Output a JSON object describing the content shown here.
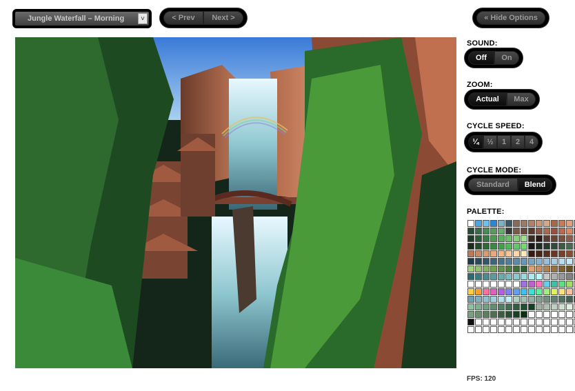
{
  "scene_select": {
    "value": "Jungle Waterfall – Morning",
    "arrow": "˅"
  },
  "nav": {
    "prev": "< Prev",
    "next": "Next >"
  },
  "options_button": "« Hide Options",
  "sound": {
    "label": "SOUND:",
    "options": [
      "Off",
      "On"
    ],
    "selected": "Off"
  },
  "zoom": {
    "label": "ZOOM:",
    "options": [
      "Actual",
      "Max"
    ],
    "selected": "Actual"
  },
  "cycle_speed": {
    "label": "CYCLE SPEED:",
    "options": [
      "¼",
      "½",
      "1",
      "2",
      "4"
    ],
    "selected": "¼"
  },
  "cycle_mode": {
    "label": "CYCLE MODE:",
    "options": [
      "Standard",
      "Blend"
    ],
    "selected": "Blend"
  },
  "palette": {
    "label": "PALETTE:",
    "colors": [
      "#ffffff",
      "#4ea6e0",
      "#6ec0f0",
      "#2c86d8",
      "#80b0c8",
      "#3a5a68",
      "#8a6a58",
      "#9a7a68",
      "#b08068",
      "#c89878",
      "#d8a888",
      "#a86848",
      "#c87a58",
      "#e0a080",
      "#a0a0a0",
      "#6a7a70",
      "#2a4a3a",
      "#3a6a4a",
      "#4a8a58",
      "#5a9a60",
      "#6aaa70",
      "#3a3a3a",
      "#7a5a48",
      "#6a4a3a",
      "#5a3a2e",
      "#8a5a46",
      "#aa6a50",
      "#9a5040",
      "#b86a4e",
      "#d88a68",
      "#7a4a3a",
      "#4a2a22",
      "#1e3a2a",
      "#2a5a3a",
      "#3a7a46",
      "#4a9a50",
      "#5ab05a",
      "#6ac068",
      "#88d078",
      "#a0e090",
      "#3a2a22",
      "#2a1a16",
      "#5a3a30",
      "#6a4436",
      "#7a5040",
      "#8a5c4a",
      "#9a6854",
      "#aa7460",
      "#1a2a1e",
      "#244a2c",
      "#2e6a38",
      "#388a42",
      "#42a04c",
      "#50b858",
      "#60c868",
      "#74d878",
      "#181818",
      "#202a24",
      "#2a3a2e",
      "#344a3a",
      "#3e5a44",
      "#486a50",
      "#527a5a",
      "#5c8a66",
      "#ba7a58",
      "#ca8a64",
      "#da9a70",
      "#eaaa7c",
      "#f0b888",
      "#f6c898",
      "#ffd8a8",
      "#ffe8c0",
      "#3a1a10",
      "#4a2416",
      "#5a2e1c",
      "#6a3822",
      "#7a4228",
      "#8a4c2e",
      "#9a5634",
      "#aa603a",
      "#223a46",
      "#2a4a58",
      "#34566a",
      "#3e647a",
      "#48728a",
      "#527e9a",
      "#5c8aaa",
      "#6896b8",
      "#78a4c4",
      "#88b2d0",
      "#98c0dc",
      "#a8cee6",
      "#b8dcf0",
      "#c8e8f8",
      "#d8f0ff",
      "#e8f8ff",
      "#a0d080",
      "#90c070",
      "#80b060",
      "#70a050",
      "#60904a",
      "#508040",
      "#407038",
      "#306030",
      "#e0a070",
      "#c89060",
      "#b08050",
      "#987040",
      "#806030",
      "#685020",
      "#504010",
      "#383000",
      "#2a6a70",
      "#3a7a80",
      "#4a8a90",
      "#5a9aa0",
      "#6aaab0",
      "#7abac0",
      "#8acad0",
      "#9adae0",
      "#aaeaf0",
      "#bafaff",
      "#c8c8c8",
      "#b0b0b0",
      "#989898",
      "#808080",
      "#686868",
      "#505050",
      "#ffffff",
      "#ffffff",
      "#ffffff",
      "#ffffff",
      "#ffffff",
      "#ffffff",
      "#ffffff",
      "#a070e0",
      "#c060d0",
      "#ff70c0",
      "#60d0f0",
      "#40c0a0",
      "#60e080",
      "#a0e060",
      "#e0e060",
      "#f0a040",
      "#ffcf40",
      "#ff9f30",
      "#ff70a0",
      "#e060c0",
      "#b060e0",
      "#8080f0",
      "#60a0f0",
      "#40c0f0",
      "#40e0d0",
      "#60f0a0",
      "#a0f080",
      "#e0f060",
      "#ffe080",
      "#ffc0a0",
      "#ffa0c0",
      "#e0a0ff",
      "#70a0b0",
      "#80b0c0",
      "#90c0d0",
      "#a0d0e0",
      "#b0e0f0",
      "#c0f0ff",
      "#b0d0c0",
      "#a0c0b0",
      "#90b0a0",
      "#80a090",
      "#709080",
      "#608070",
      "#507060",
      "#406050",
      "#305040",
      "#203030",
      "#90c0a0",
      "#80b090",
      "#70a080",
      "#609070",
      "#508060",
      "#407050",
      "#306040",
      "#205030",
      "#104020",
      "#a0b0a0",
      "#b0c0b0",
      "#c0d0c0",
      "#d0e0d0",
      "#e0f0e0",
      "#f0fff0",
      "#ffffff",
      "#7aa080",
      "#6a9070",
      "#5a8060",
      "#4a7050",
      "#3a6040",
      "#2a5030",
      "#1a4020",
      "#0a3010",
      "#ffffff",
      "#ffffff",
      "#ffffff",
      "#ffffff",
      "#ffffff",
      "#ffffff",
      "#ffffff",
      "#ffffff",
      "#101010",
      "#ffffff",
      "#ffffff",
      "#ffffff",
      "#ffffff",
      "#ffffff",
      "#ffffff",
      "#ffffff",
      "#ffffff",
      "#ffffff",
      "#ffffff",
      "#ffffff",
      "#ffffff",
      "#ffffff",
      "#ffffff",
      "#ffffff",
      "#ffffff",
      "#ffffff",
      "#ffffff",
      "#ffffff",
      "#ffffff",
      "#ffffff",
      "#ffffff",
      "#ffffff",
      "#ffffff",
      "#ffffff",
      "#ffffff",
      "#ffffff",
      "#ffffff",
      "#ffffff",
      "#ffffff",
      "#ffffff"
    ]
  },
  "fps": "FPS: 120"
}
